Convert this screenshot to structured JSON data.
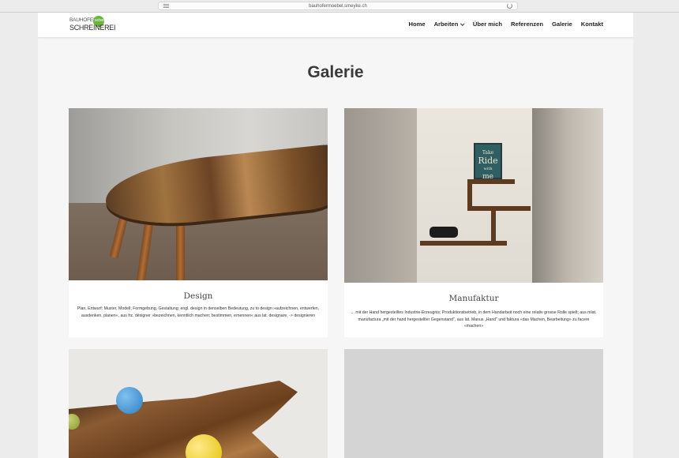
{
  "browser": {
    "url": "bauhofermoebel.smeyke.ch"
  },
  "logo": {
    "top": "BAUHOFER",
    "dot": "MÖBEL",
    "bottom": "SCHREINEREI"
  },
  "nav": {
    "items": [
      "Home",
      "Arbeiten",
      "Über mich",
      "Referenzen",
      "Galerie",
      "Kontakt"
    ]
  },
  "page": {
    "title": "Galerie"
  },
  "gallery": [
    {
      "title": "Design",
      "text": "Plan, Entwurf; Muster, Modell; Formgebung, Gestaltung; engl. design in denselben Bedeutung, zu to design »aufzeichnen, entwerfen, ausdenken, planen«, aus frz. désigner »bezeichnen, kenntlich machen; bestimmen, ernennen« aus lat. designare, -> designieren"
    },
    {
      "title": "Manufaktur",
      "text": "... mit der Hand hergestelltes Industrie-Erzeugnis; Produktionsbetrieb, in dem Handarbeit noch eine relativ grosse Rolle spielt; aus mlat. manufactura „mit der hand hergestellter Gegenstand\", aus lat. Manus „Hand\" und faktura «das Machen, Bearbeitung» zu facere «machen»"
    }
  ],
  "artwork": {
    "frame_text": [
      "Take",
      "Ride",
      "with",
      "me"
    ]
  }
}
